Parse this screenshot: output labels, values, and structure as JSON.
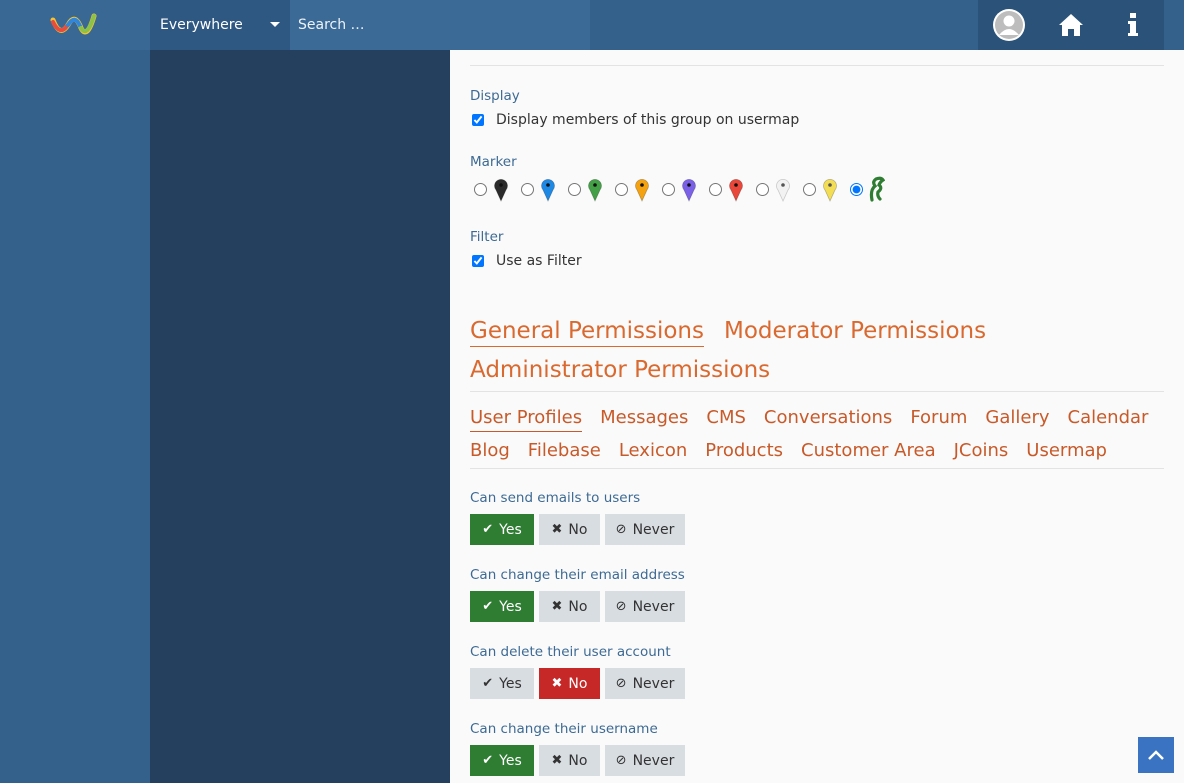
{
  "header": {
    "scope_label": "Everywhere",
    "search_placeholder": "Search …"
  },
  "usermap": {
    "display_label": "Display",
    "display_checkbox": "Display members of this group on usermap",
    "marker_label": "Marker",
    "markers": [
      {
        "color": "#2b2b2b",
        "icon": "marker-black-icon",
        "selected": false
      },
      {
        "color": "#1e88e5",
        "icon": "marker-blue-icon",
        "selected": false
      },
      {
        "color": "#43a047",
        "icon": "marker-green-icon",
        "selected": false
      },
      {
        "color": "#f4a20f",
        "icon": "marker-orange-icon",
        "selected": false
      },
      {
        "color": "#7b61e8",
        "icon": "marker-purple-icon",
        "selected": false
      },
      {
        "color": "#e8473a",
        "icon": "marker-red-icon",
        "selected": false
      },
      {
        "color": "#f2f2f2",
        "icon": "marker-white-icon",
        "selected": false
      },
      {
        "color": "#f2dd55",
        "icon": "marker-yellow-icon",
        "selected": false
      },
      {
        "color": "#2e7d32",
        "icon": "marker-custom-icon",
        "selected": true
      }
    ],
    "filter_label": "Filter",
    "filter_checkbox": "Use as Filter"
  },
  "permission_tabs": [
    "General Permissions",
    "Moderator Permissions",
    "Administrator Permissions"
  ],
  "category_tabs_row1": [
    "User Profiles",
    "Messages",
    "CMS",
    "Conversations",
    "Forum",
    "Gallery",
    "Calendar"
  ],
  "category_tabs_row2": [
    "Blog",
    "Filebase",
    "Lexicon",
    "Products",
    "Customer Area",
    "JCoins",
    "Usermap"
  ],
  "buttons": {
    "yes": "Yes",
    "no": "No",
    "never": "Never"
  },
  "permissions": [
    {
      "label": "Can send emails to users",
      "value": "yes"
    },
    {
      "label": "Can change their email address",
      "value": "yes"
    },
    {
      "label": "Can delete their user account",
      "value": "no"
    },
    {
      "label": "Can change their username",
      "value": "yes"
    }
  ],
  "colors": {
    "accent": "#d9692f",
    "yes": "#2e7d32",
    "no": "#c62828",
    "topbar": "#34618c"
  }
}
